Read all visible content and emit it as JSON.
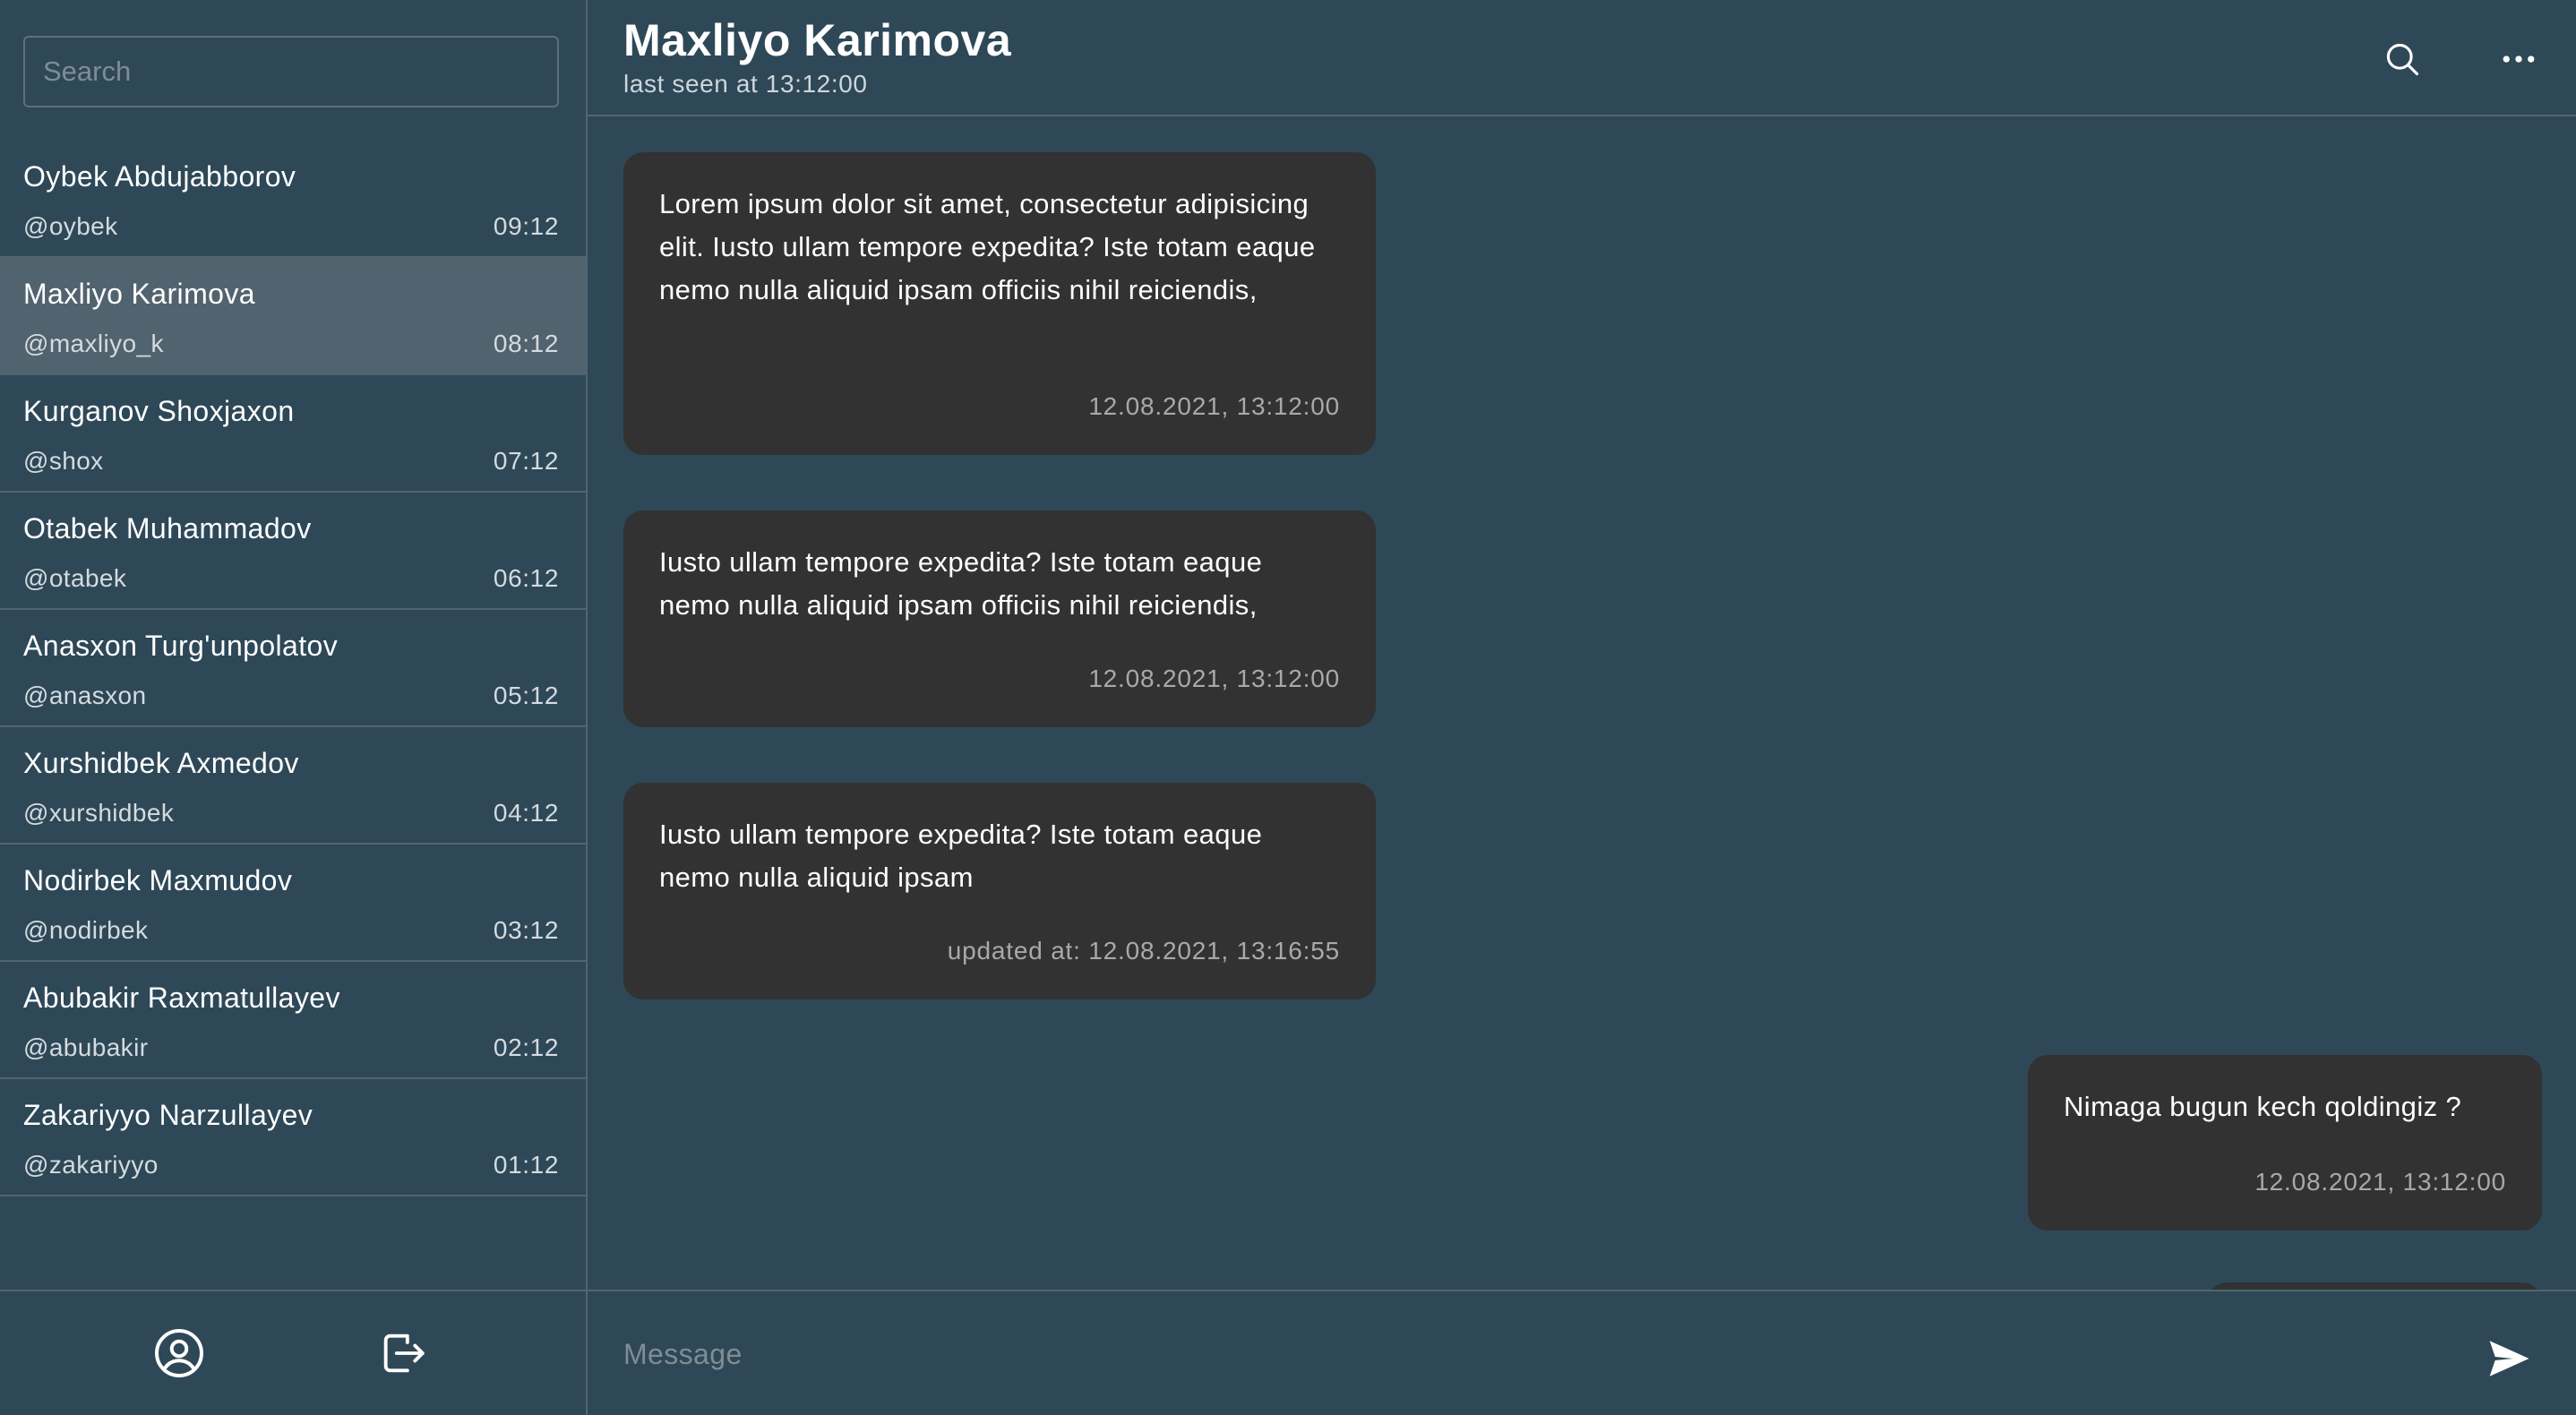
{
  "sidebar": {
    "search_placeholder": "Search",
    "chats": [
      {
        "name": "Oybek Abdujabborov",
        "handle": "@oybek",
        "time": "09:12",
        "active": false
      },
      {
        "name": "Maxliyo Karimova",
        "handle": "@maxliyo_k",
        "time": "08:12",
        "active": true
      },
      {
        "name": "Kurganov Shoxjaxon",
        "handle": "@shox",
        "time": "07:12",
        "active": false
      },
      {
        "name": "Otabek Muhammadov",
        "handle": "@otabek",
        "time": "06:12",
        "active": false
      },
      {
        "name": "Anasxon Turg'unpolatov",
        "handle": "@anasxon",
        "time": "05:12",
        "active": false
      },
      {
        "name": "Xurshidbek Axmedov",
        "handle": "@xurshidbek",
        "time": "04:12",
        "active": false
      },
      {
        "name": "Nodirbek Maxmudov",
        "handle": "@nodirbek",
        "time": "03:12",
        "active": false
      },
      {
        "name": "Abubakir Raxmatullayev",
        "handle": "@abubakir",
        "time": "02:12",
        "active": false
      },
      {
        "name": "Zakariyyo Narzullayev",
        "handle": "@zakariyyo",
        "time": "01:12",
        "active": false
      }
    ],
    "footer_icons": [
      "user-circle-icon",
      "logout-icon"
    ]
  },
  "header": {
    "title": "Maxliyo Karimova",
    "subtitle": "last seen at 13:12:00",
    "icons": [
      "search-icon",
      "more-horizontal-icon"
    ]
  },
  "messages": [
    {
      "text": "Lorem ipsum dolor sit amet, consectetur adipisicing elit. Iusto ullam tempore expedita? Iste totam eaque nemo nulla aliquid ipsam officiis nihil reiciendis,",
      "time": "12.08.2021, 13:12:00",
      "side": "left"
    },
    {
      "text": "Iusto ullam tempore expedita? Iste totam eaque nemo nulla aliquid ipsam officiis nihil reiciendis,",
      "time": "12.08.2021, 13:12:00",
      "side": "left"
    },
    {
      "text": "Iusto ullam tempore expedita? Iste totam eaque nemo nulla aliquid ipsam",
      "time": "updated at: 12.08.2021, 13:16:55",
      "side": "left"
    },
    {
      "text": "Nimaga bugun kech qoldingiz ?",
      "time": "12.08.2021, 13:12:00",
      "side": "right"
    }
  ],
  "composer": {
    "placeholder": "Message",
    "send_icon": "send-icon"
  },
  "colors": {
    "background": "#2e4857",
    "active_item": "#51636e",
    "bubble": "#323232",
    "divider": "#52656f",
    "muted_text": "#a9a9a9"
  }
}
